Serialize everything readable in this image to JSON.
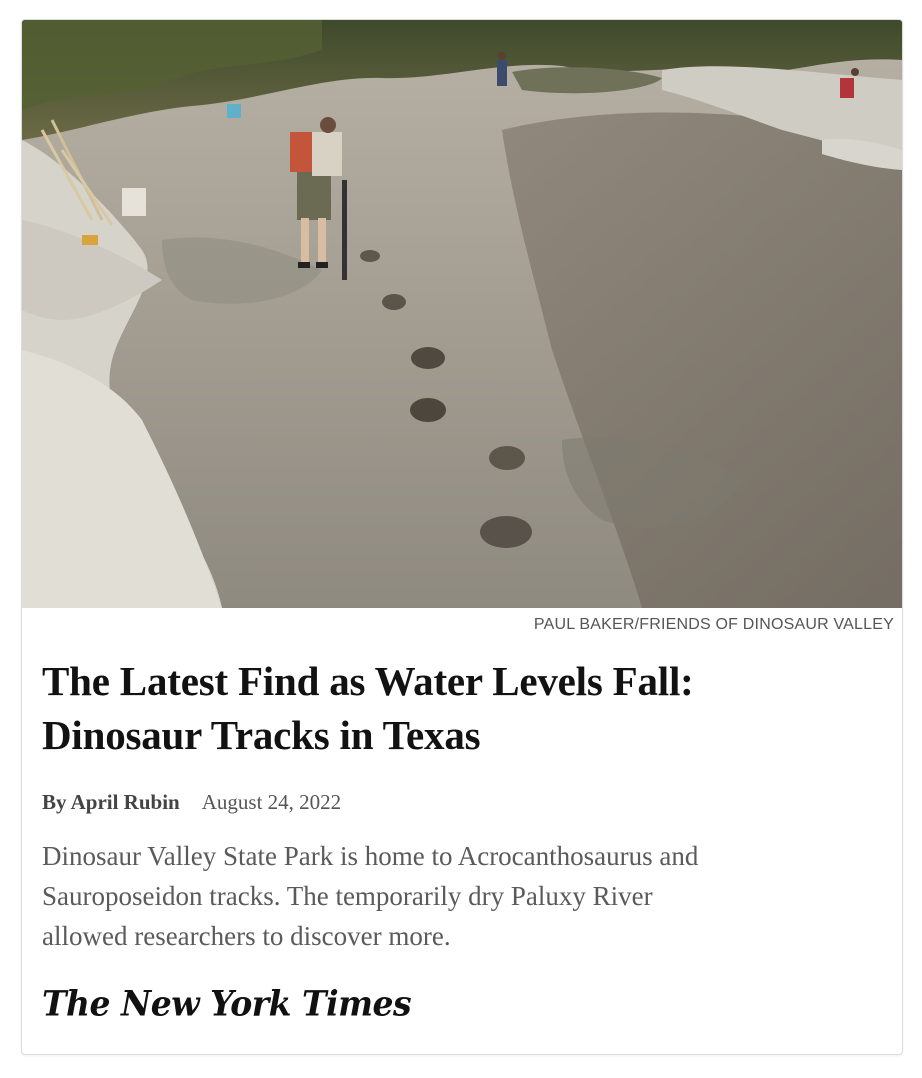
{
  "article": {
    "photo_alt": "Dinosaur tracks in dry riverbed",
    "photo_credit": "PAUL BAKER/FRIENDS OF DINOSAUR VALLEY",
    "headline_line1": "The Latest Find as Water Levels Fall:",
    "headline_line2": "Dinosaur Tracks in Texas",
    "byline": "By April Rubin",
    "date": "August 24, 2022",
    "summary_line1": "Dinosaur Valley State Park is home to Acrocanthosaurus and",
    "summary_line2": "Sauroposeidon tracks. The temporarily dry Paluxy River",
    "summary_line3": "allowed researchers to discover more."
  },
  "publisher": {
    "logo_text": "The New York Times"
  }
}
